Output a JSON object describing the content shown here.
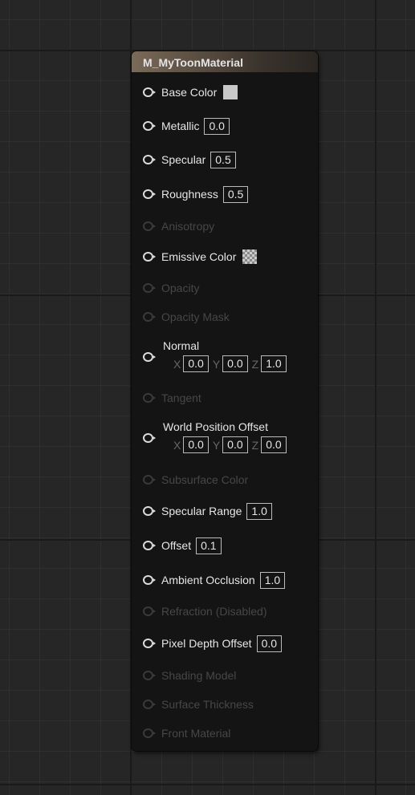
{
  "node": {
    "title": "M_MyToonMaterial",
    "pins": [
      {
        "label": "Base Color",
        "enabled": true,
        "widget": "color",
        "color": "#c8c8c8"
      },
      {
        "label": "Metallic",
        "enabled": true,
        "value": "0.0"
      },
      {
        "label": "Specular",
        "enabled": true,
        "value": "0.5"
      },
      {
        "label": "Roughness",
        "enabled": true,
        "value": "0.5"
      },
      {
        "label": "Anisotropy",
        "enabled": false
      },
      {
        "label": "Emissive Color",
        "enabled": true,
        "widget": "checker"
      },
      {
        "label": "Opacity",
        "enabled": false
      },
      {
        "label": "Opacity Mask",
        "enabled": false
      },
      {
        "label": "Normal",
        "enabled": true,
        "x": "0.0",
        "y": "0.0",
        "z": "1.0"
      },
      {
        "label": "Tangent",
        "enabled": false
      },
      {
        "label": "World Position Offset",
        "enabled": true,
        "x": "0.0",
        "y": "0.0",
        "z": "0.0"
      },
      {
        "label": "Subsurface Color",
        "enabled": false
      },
      {
        "label": "Specular Range",
        "enabled": true,
        "value": "1.0"
      },
      {
        "label": "Offset",
        "enabled": true,
        "value": "0.1"
      },
      {
        "label": "Ambient Occlusion",
        "enabled": true,
        "value": "1.0"
      },
      {
        "label": "Refraction (Disabled)",
        "enabled": false
      },
      {
        "label": "Pixel Depth Offset",
        "enabled": true,
        "value": "0.0"
      },
      {
        "label": "Shading Model",
        "enabled": false
      },
      {
        "label": "Surface Thickness",
        "enabled": false
      },
      {
        "label": "Front Material",
        "enabled": false
      }
    ],
    "axis_labels": {
      "x": "X",
      "y": "Y",
      "z": "Z"
    }
  }
}
